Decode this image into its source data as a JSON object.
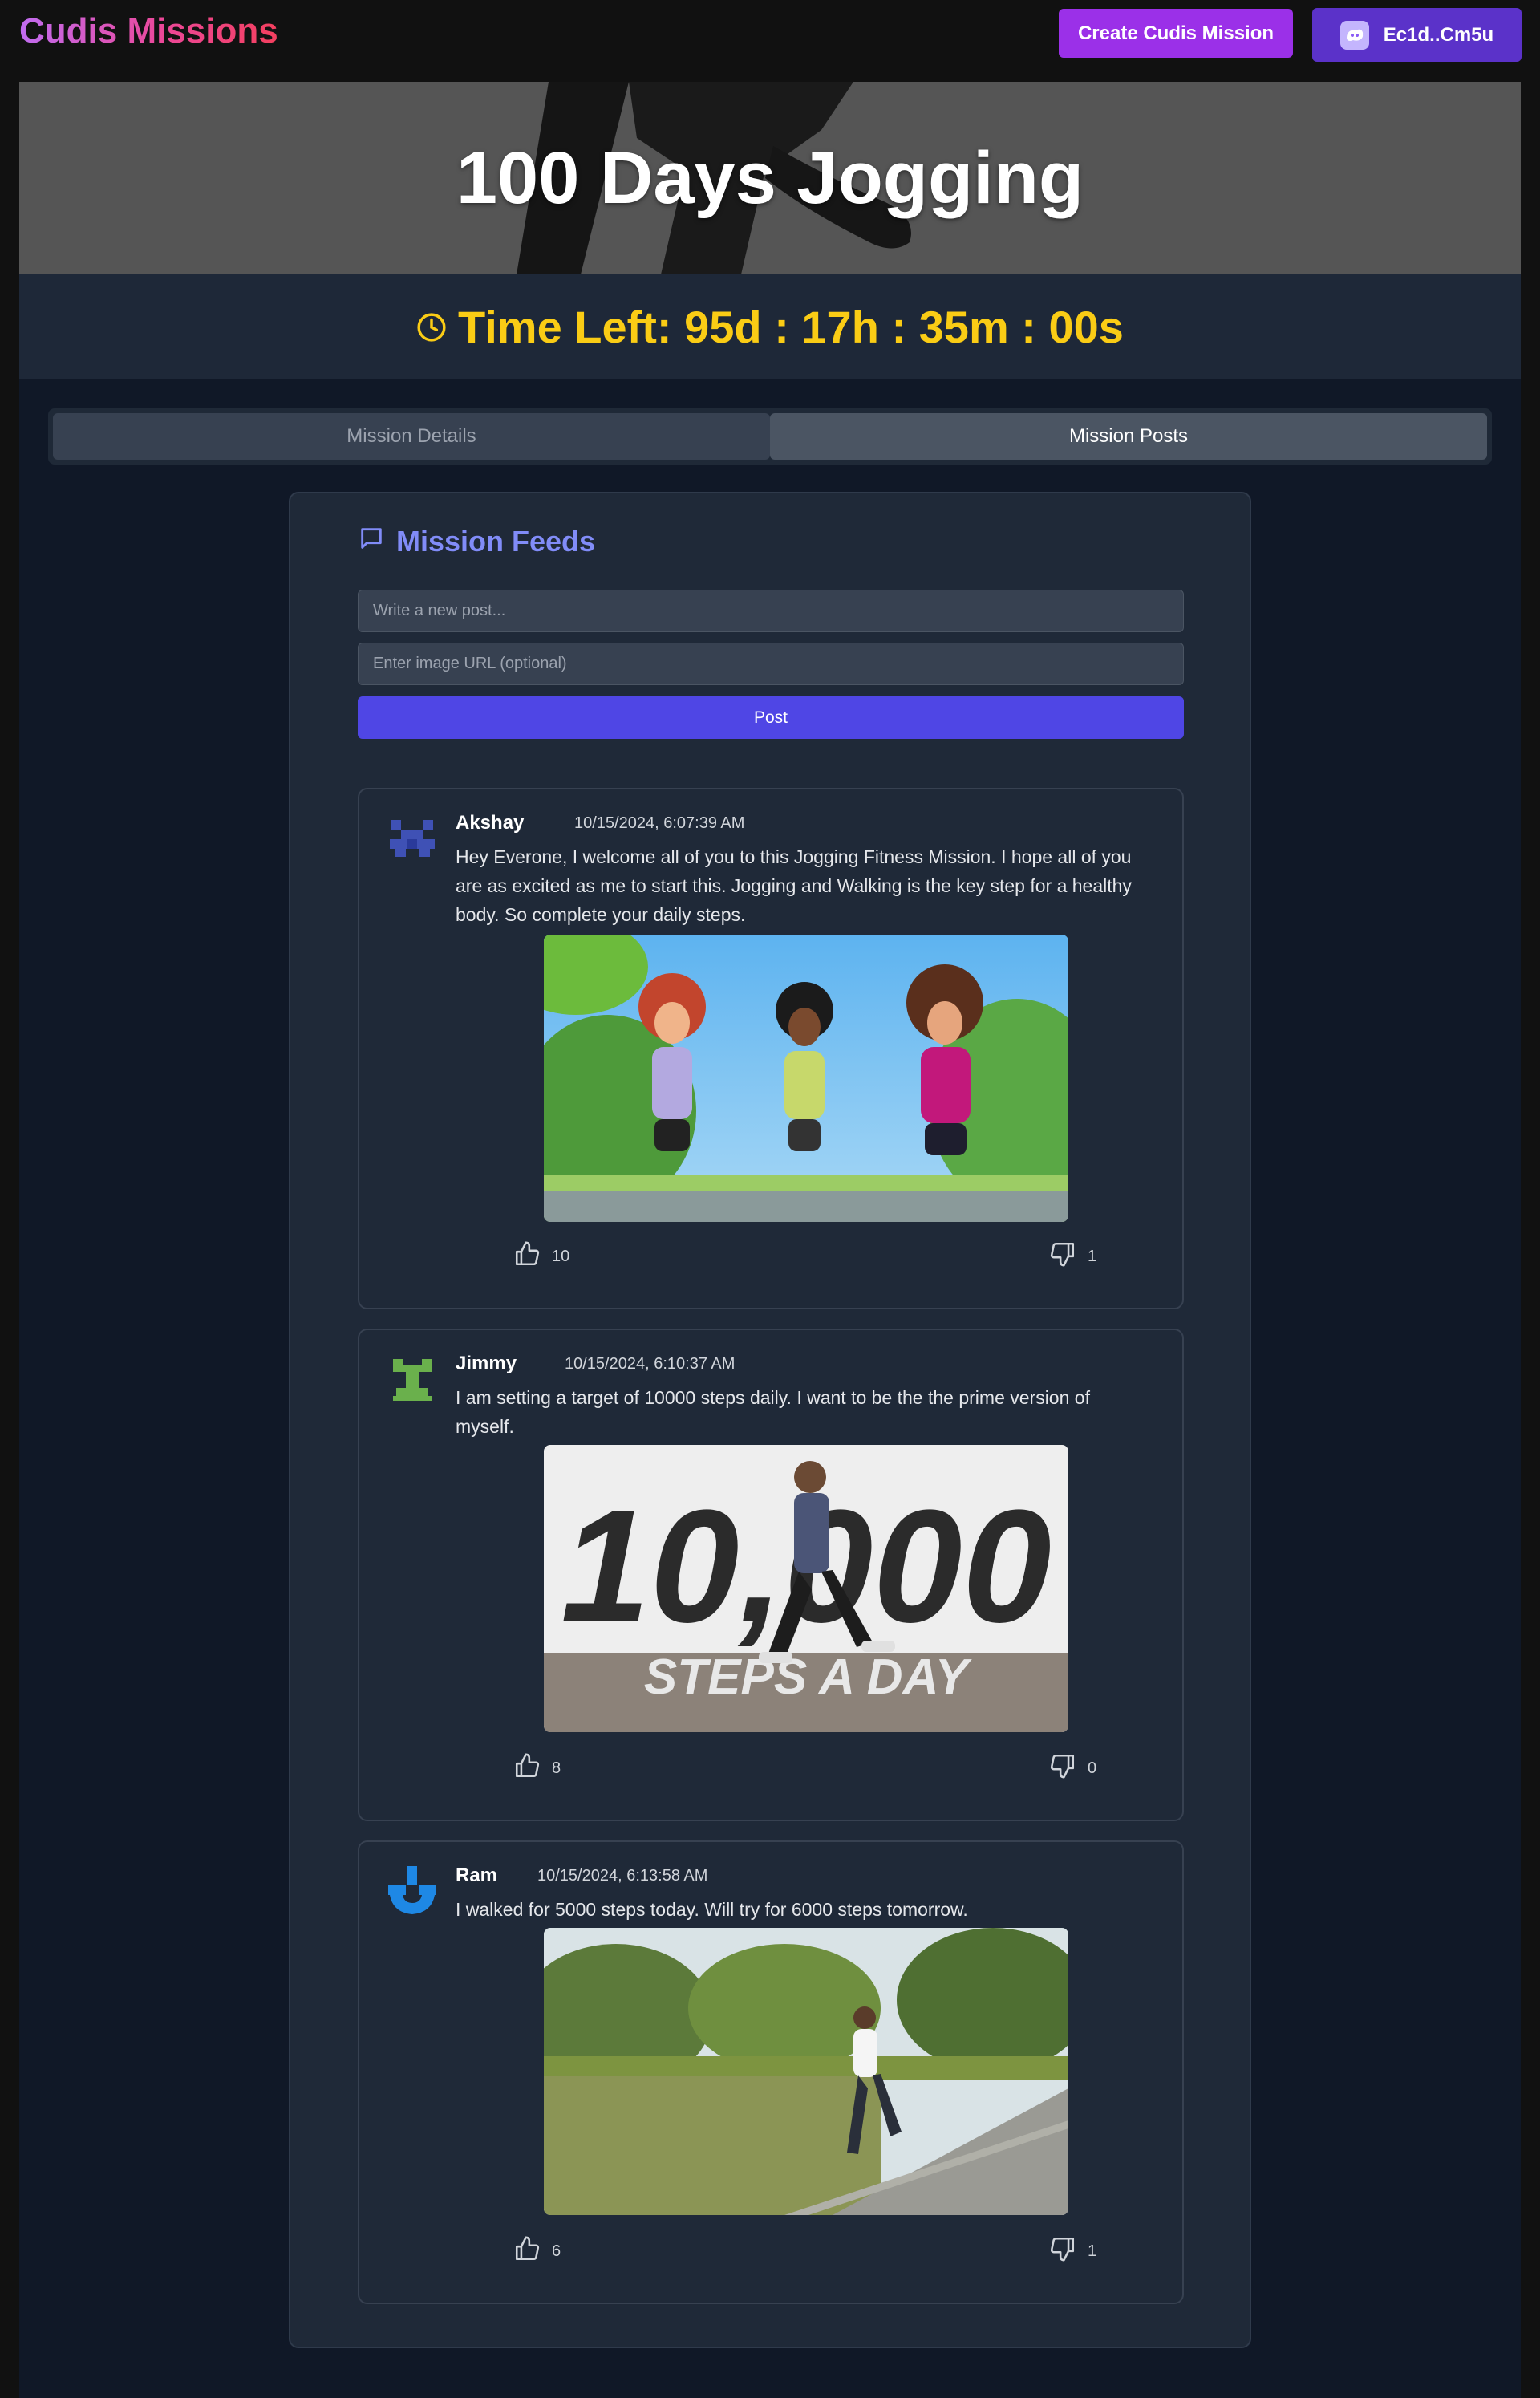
{
  "header": {
    "brand": "Cudis Missions",
    "create_button": "Create Cudis Mission",
    "wallet_label": "Ec1d..Cm5u",
    "colors": {
      "brand_start": "#c06cf0",
      "brand_end": "#f43f5e",
      "create_bg": "#9b30e8",
      "wallet_bg": "#5b32c9"
    }
  },
  "mission": {
    "title": "100 Days Jogging",
    "time_left": "Time Left: 95d : 17h : 35m : 00s",
    "timer_color": "#facc15"
  },
  "tabs": [
    {
      "label": "Mission Details",
      "active": false
    },
    {
      "label": "Mission Posts",
      "active": true
    }
  ],
  "feed": {
    "title": "Mission Feeds",
    "post_placeholder": "Write a new post...",
    "image_placeholder": "Enter image URL (optional)",
    "post_button": "Post",
    "accent": "#4f46e5"
  },
  "posts": [
    {
      "user": "Akshay",
      "time": "10/15/2024, 6:07:39 AM",
      "text": "Hey Everone, I welcome all of you to this Jogging Fitness Mission. I hope all of you are as excited as me to start this. Jogging and Walking is the key step for a healthy body. So complete your daily steps.",
      "image": "illustration of three women jogging in a park",
      "likes": "10",
      "dislikes": "1",
      "avatar_color": "#3f51b5"
    },
    {
      "user": "Jimmy",
      "time": "10/15/2024, 6:10:37 AM",
      "text": "I am setting a target of 10000 steps daily. I want to be the the prime version of myself.",
      "image": "man walking in front of 10,000 steps a day text",
      "likes": "8",
      "dislikes": "0",
      "avatar_color": "#6ab04c"
    },
    {
      "user": "Ram",
      "time": "10/15/2024, 6:13:58 AM",
      "text": "I walked for 5000 steps today. Will try for 6000 steps tomorrow.",
      "image": "woman jogging on a path beside a lake",
      "likes": "6",
      "dislikes": "1",
      "avatar_color": "#1e88e5"
    }
  ]
}
